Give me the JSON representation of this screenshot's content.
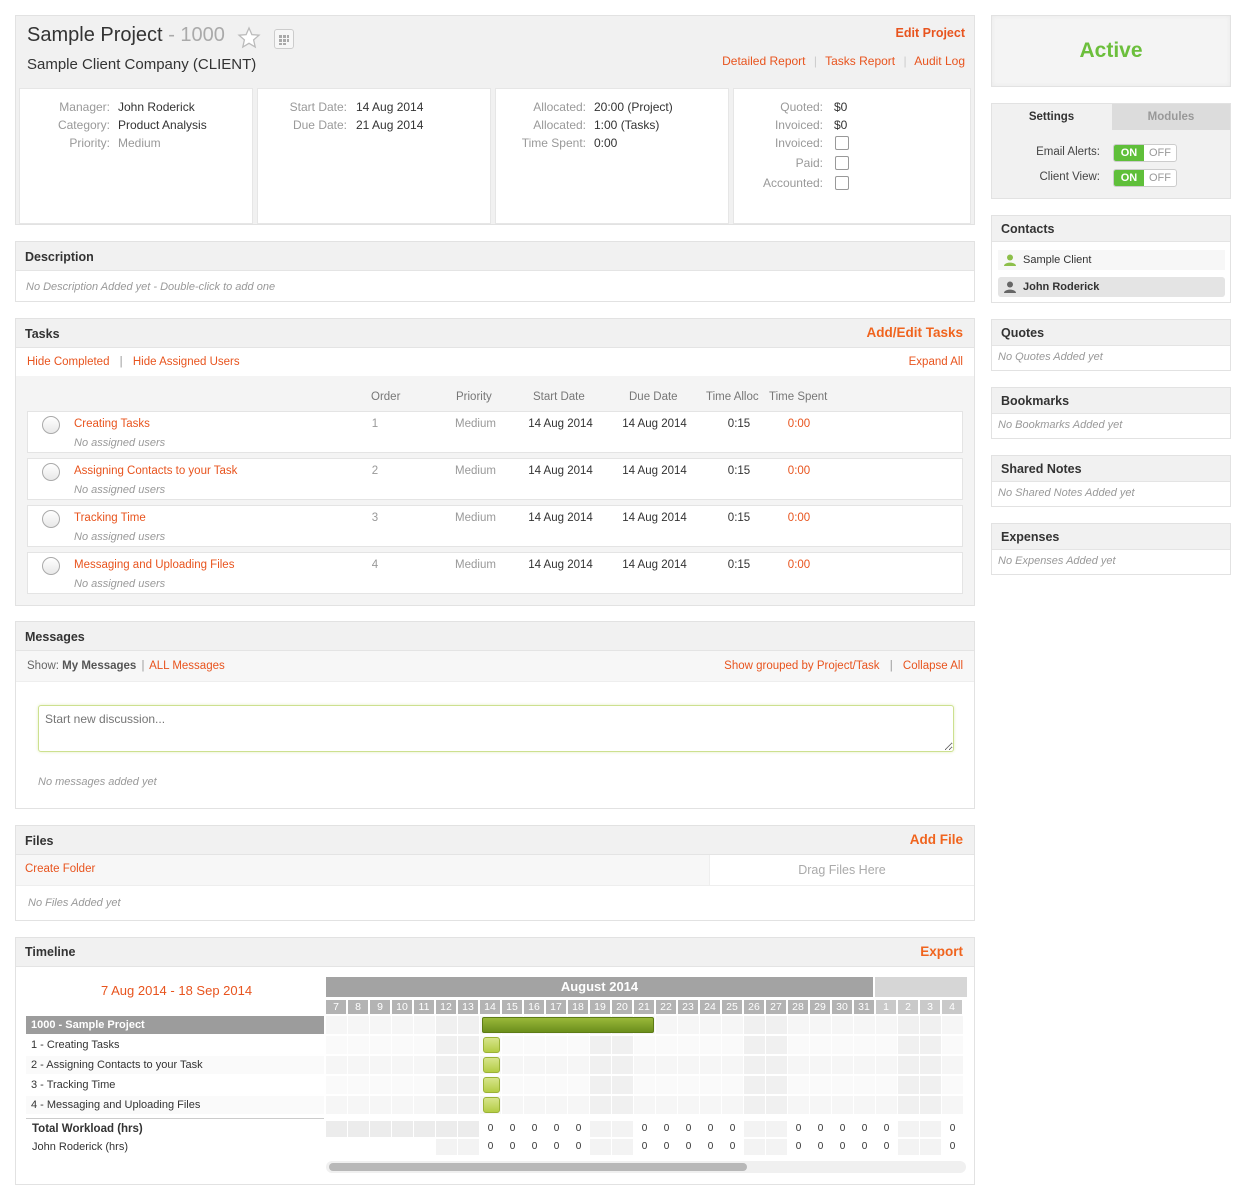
{
  "project": {
    "name": "Sample Project",
    "number": "- 1000",
    "client": "Sample Client Company (CLIENT)",
    "edit_label": "Edit Project",
    "links": [
      "Detailed Report",
      "Tasks Report",
      "Audit Log"
    ],
    "sep": "|"
  },
  "info": {
    "manager_label": "Manager:",
    "manager": "John Roderick",
    "category_label": "Category:",
    "category": "Product Analysis",
    "priority_label": "Priority:",
    "priority": "Medium",
    "start_label": "Start Date:",
    "start": "14 Aug 2014",
    "due_label": "Due Date:",
    "due": "21 Aug 2014",
    "alloc_label": "Allocated:",
    "alloc_project": "20:00 (Project)",
    "alloc_tasks": "1:00 (Tasks)",
    "spent_label": "Time Spent:",
    "spent": "0:00",
    "quoted_label": "Quoted:",
    "quoted": "$0",
    "invoiced_label": "Invoiced:",
    "invoiced": "$0",
    "invoiced2_label": "Invoiced:",
    "paid_label": "Paid:",
    "accounted_label": "Accounted:"
  },
  "description": {
    "title": "Description",
    "empty": "No Description Added yet - Double-click to add one"
  },
  "tasks": {
    "title": "Tasks",
    "action": "Add/Edit Tasks",
    "hide_completed": "Hide Completed",
    "hide_users": "Hide Assigned Users",
    "sep": "|",
    "expand": "Expand All",
    "columns": [
      "Order",
      "Priority",
      "Start Date",
      "Due Date",
      "Time Alloc",
      "Time Spent"
    ],
    "rows": [
      {
        "name": "Creating Tasks",
        "users": "No assigned users",
        "order": "1",
        "priority": "Medium",
        "start": "14 Aug 2014",
        "due": "14 Aug 2014",
        "alloc": "0:15",
        "spent": "0:00"
      },
      {
        "name": "Assigning Contacts to your Task",
        "users": "No assigned users",
        "order": "2",
        "priority": "Medium",
        "start": "14 Aug 2014",
        "due": "14 Aug 2014",
        "alloc": "0:15",
        "spent": "0:00"
      },
      {
        "name": "Tracking Time",
        "users": "No assigned users",
        "order": "3",
        "priority": "Medium",
        "start": "14 Aug 2014",
        "due": "14 Aug 2014",
        "alloc": "0:15",
        "spent": "0:00"
      },
      {
        "name": "Messaging and Uploading Files",
        "users": "No assigned users",
        "order": "4",
        "priority": "Medium",
        "start": "14 Aug 2014",
        "due": "14 Aug 2014",
        "alloc": "0:15",
        "spent": "0:00"
      }
    ]
  },
  "messages": {
    "title": "Messages",
    "show_label": "Show:",
    "my": "My Messages",
    "sep": "|",
    "all": "ALL Messages",
    "grouped": "Show grouped by Project/Task",
    "collapse": "Collapse All",
    "placeholder": "Start new discussion...",
    "empty": "No messages added yet"
  },
  "files": {
    "title": "Files",
    "action": "Add File",
    "create_folder": "Create Folder",
    "drop": "Drag Files Here",
    "empty": "No Files Added yet"
  },
  "timeline": {
    "title": "Timeline",
    "action": "Export",
    "range": "7 Aug 2014 - 18 Sep 2014",
    "month": "August 2014",
    "days": [
      "7",
      "8",
      "9",
      "10",
      "11",
      "12",
      "13",
      "14",
      "15",
      "16",
      "17",
      "18",
      "19",
      "20",
      "21",
      "22",
      "23",
      "24",
      "25",
      "26",
      "27",
      "28",
      "29",
      "30",
      "31",
      "1",
      "2",
      "3",
      "4"
    ],
    "rows": [
      "1000 - Sample Project",
      "1 - Creating Tasks",
      "2 - Assigning Contacts to your Task",
      "3 - Tracking Time",
      "4 - Messaging and Uploading Files"
    ],
    "workload_label": "Total Workload (hrs)",
    "user_label": "John Roderick (hrs)",
    "zero": "0"
  },
  "sidebar": {
    "status": "Active",
    "tabs": [
      "Settings",
      "Modules"
    ],
    "email_alerts": "Email Alerts:",
    "client_view": "Client View:",
    "on": "ON",
    "off": "OFF",
    "contacts_title": "Contacts",
    "contacts": [
      "Sample Client",
      "John Roderick"
    ],
    "quotes_title": "Quotes",
    "quotes_empty": "No Quotes Added yet",
    "bookmarks_title": "Bookmarks",
    "bookmarks_empty": "No Bookmarks Added yet",
    "notes_title": "Shared Notes",
    "notes_empty": "No Shared Notes Added yet",
    "expenses_title": "Expenses",
    "expenses_empty": "No Expenses Added yet"
  },
  "colors": {
    "accent": "#e8541e",
    "active_green": "#6cbf3c",
    "bar_green": "#7a9a1e"
  }
}
